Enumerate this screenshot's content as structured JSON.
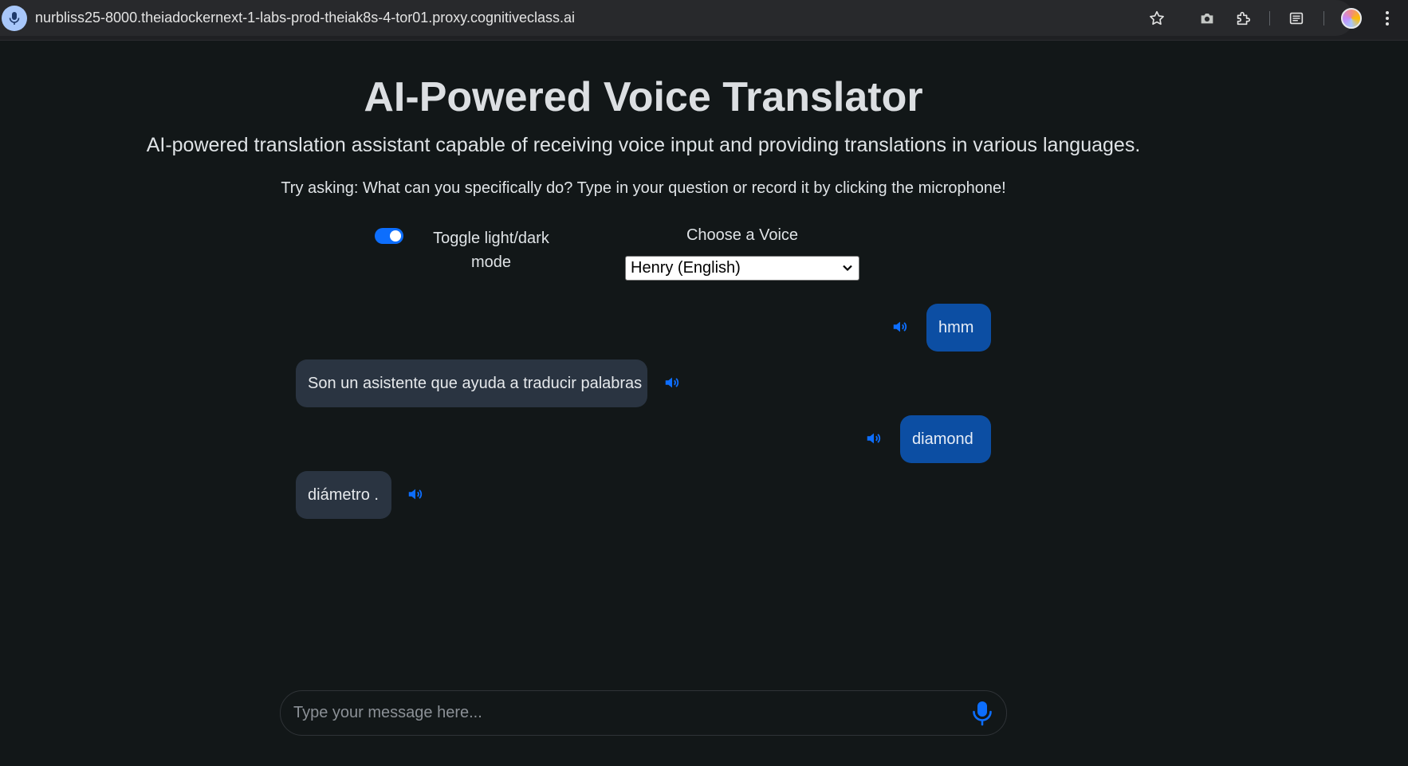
{
  "browser": {
    "url": "nurbliss25-8000.theiadockernext-1-labs-prod-theiak8s-4-tor01.proxy.cognitiveclass.ai"
  },
  "page": {
    "title": "AI-Powered Voice Translator",
    "subtitle": "AI-powered translation assistant capable of receiving voice input and providing translations in various languages.",
    "hint": "Try asking: What can you specifically do? Type in your question or record it by clicking the microphone!"
  },
  "controls": {
    "theme_toggle": {
      "label": "Toggle light/dark mode",
      "on": true
    },
    "voice": {
      "label": "Choose a Voice",
      "selected": "Henry (English)"
    }
  },
  "chat": {
    "messages": [
      {
        "role": "user",
        "text": "hmm"
      },
      {
        "role": "bot",
        "text": "Son un asistente que ayuda a traducir palabras"
      },
      {
        "role": "user",
        "text": "diamond"
      },
      {
        "role": "bot",
        "text": "diámetro ."
      }
    ]
  },
  "composer": {
    "placeholder": "Type your message here..."
  },
  "icons": {
    "site_info": "microphone-icon",
    "speaker": "volume-icon",
    "mic": "microphone-icon"
  },
  "colors": {
    "accent": "#0d6efd",
    "user_bubble": "#0c4ea3",
    "bot_bubble": "#2a3441",
    "background": "#121718"
  }
}
